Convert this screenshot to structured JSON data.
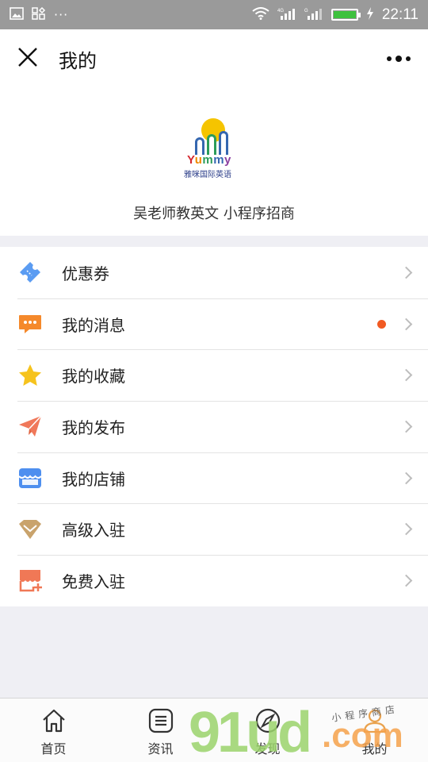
{
  "status_bar": {
    "left_icons": [
      "image-icon",
      "apps-icon"
    ],
    "dots": "···",
    "network": "4G",
    "time": "22:11",
    "battery_level": 1.0
  },
  "nav": {
    "title": "我的"
  },
  "profile": {
    "logo_text": "Yummy",
    "logo_sub": "雅咪国际英语",
    "name": "吴老师教英文 小程序招商"
  },
  "menu": [
    {
      "label": "优惠券",
      "icon": "ticket-icon",
      "dot": false
    },
    {
      "label": "我的消息",
      "icon": "message-icon",
      "dot": true
    },
    {
      "label": "我的收藏",
      "icon": "star-icon",
      "dot": false
    },
    {
      "label": "我的发布",
      "icon": "send-icon",
      "dot": false
    },
    {
      "label": "我的店铺",
      "icon": "shop-icon",
      "dot": false
    },
    {
      "label": "高级入驻",
      "icon": "diamond-icon",
      "dot": false
    },
    {
      "label": "免费入驻",
      "icon": "store-add-icon",
      "dot": false
    }
  ],
  "colors": {
    "ticket": "#5b9cf2",
    "message": "#f5892b",
    "star": "#f6c31d",
    "send": "#f0785a",
    "shop": "#4e8fef",
    "diamond": "#c9a36c",
    "store_add": "#f07856",
    "badge": "#f15a22"
  },
  "tabs": [
    {
      "label": "首页",
      "icon": "home-icon"
    },
    {
      "label": "资讯",
      "icon": "news-icon"
    },
    {
      "label": "发现",
      "icon": "compass-icon"
    },
    {
      "label": "我的",
      "icon": "user-icon"
    }
  ],
  "watermark": {
    "main": "91ud",
    "suffix": ".com",
    "tag": "小程序商店"
  }
}
